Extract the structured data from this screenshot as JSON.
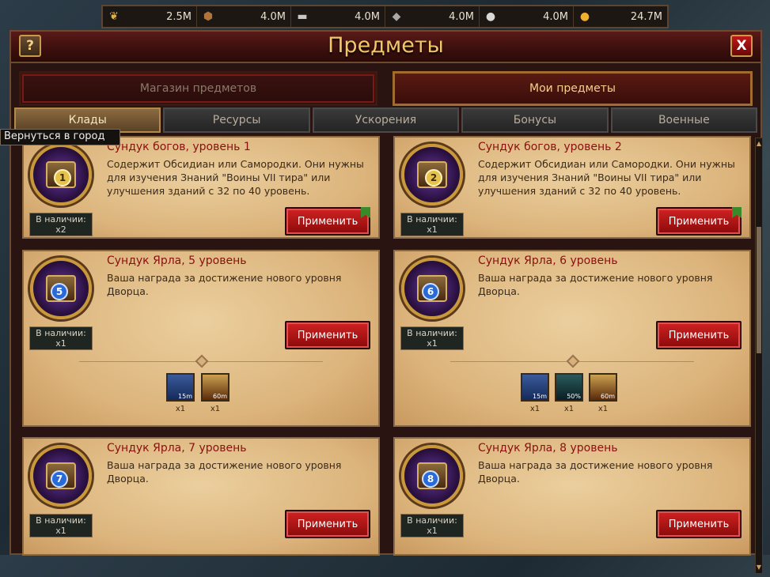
{
  "resources": [
    {
      "icon": "wheat-icon",
      "value": "2.5M"
    },
    {
      "icon": "wood-icon",
      "value": "4.0M"
    },
    {
      "icon": "iron-icon",
      "value": "4.0M"
    },
    {
      "icon": "stone-icon",
      "value": "4.0M"
    },
    {
      "icon": "silver-icon",
      "value": "4.0M"
    },
    {
      "icon": "gold-coin-icon",
      "value": "24.7M"
    }
  ],
  "window": {
    "title": "Предметы",
    "help_label": "?",
    "close_label": "X"
  },
  "tabs": {
    "shop": "Магазин предметов",
    "my": "Мои предметы"
  },
  "subtabs": [
    "Клады",
    "Ресурсы",
    "Ускорения",
    "Бонусы",
    "Военные"
  ],
  "tooltip": "Вернуться в город",
  "stock_label": "В наличии:",
  "apply_label": "Применить",
  "items": [
    {
      "title": "Сундук богов, уровень 1",
      "desc": "Содержит Обсидиан или Самородки. Они нужны для изучения Знаний \"Воины VII тира\" или улучшения зданий с 32 по 40 уровень.",
      "qty": "x2",
      "badge": "1"
    },
    {
      "title": "Сундук богов, уровень 2",
      "desc": "Содержит Обсидиан или Самородки. Они нужны для изучения Знаний \"Воины VII тира\" или улучшения зданий с 32 по 40 уровень.",
      "qty": "x1",
      "badge": "2"
    },
    {
      "title": "Сундук Ярла, 5 уровень",
      "desc": "Ваша награда за достижение нового уровня Дворца.",
      "qty": "x1",
      "badge": "5"
    },
    {
      "title": "Сундук Ярла, 6 уровень",
      "desc": "Ваша награда за достижение нового уровня Дворца.",
      "qty": "x1",
      "badge": "6"
    },
    {
      "title": "Сундук Ярла, 7 уровень",
      "desc": "Ваша награда за достижение нового уровня Дворца.",
      "qty": "x1",
      "badge": "7"
    },
    {
      "title": "Сундук Ярла, 8 уровень",
      "desc": "Ваша награда за достижение нового уровня Дворца.",
      "qty": "x1",
      "badge": "8"
    }
  ],
  "rewards": {
    "card3": [
      {
        "icon": "hourglass-icon",
        "label": "15m",
        "qty": "x1"
      },
      {
        "icon": "helmet-icon",
        "label": "60m",
        "qty": "x1"
      }
    ],
    "card4": [
      {
        "icon": "hourglass-icon",
        "label": "15m",
        "qty": "x1"
      },
      {
        "icon": "cure-icon",
        "label": "50%",
        "qty": "x1"
      },
      {
        "icon": "helmet-icon",
        "label": "60m",
        "qty": "x1"
      }
    ]
  }
}
